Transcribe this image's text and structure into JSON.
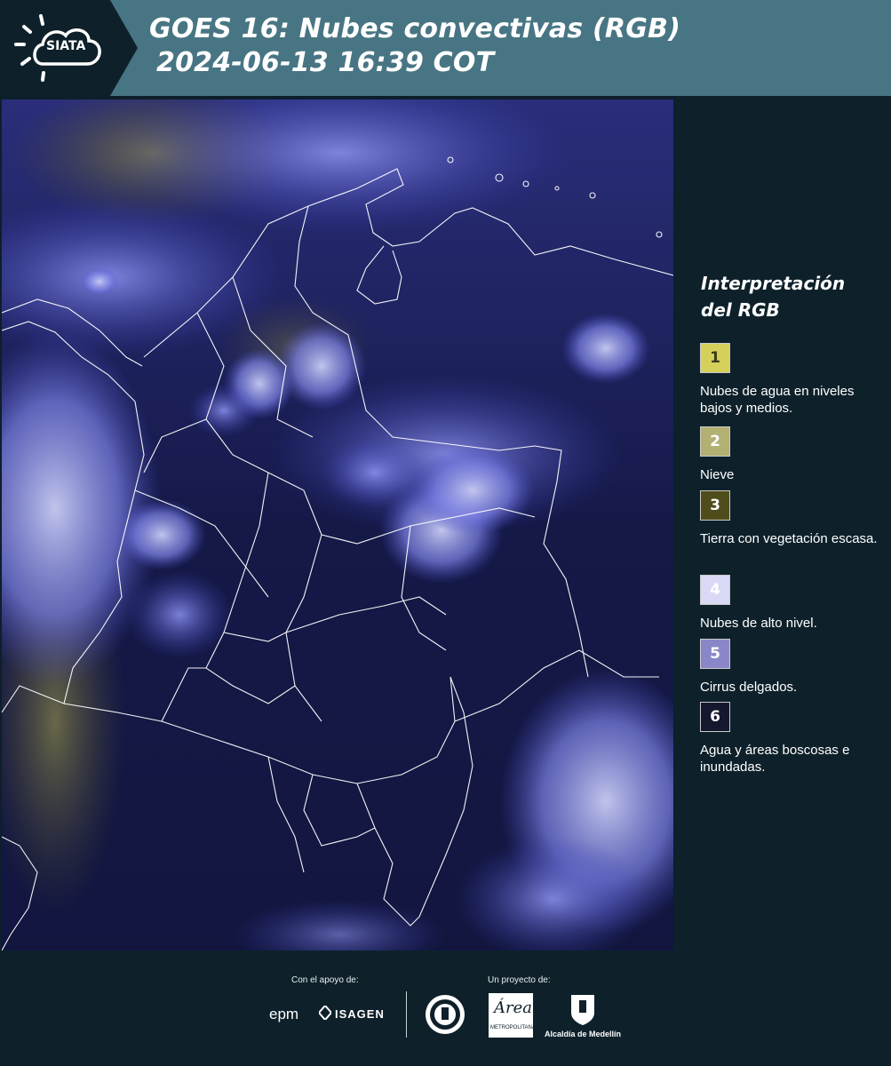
{
  "header": {
    "logo_text": "SIATA",
    "title_line1": "GOES 16: Nubes convectivas (RGB)",
    "title_line2": "2024-06-13 16:39 COT",
    "background_color": "#487583"
  },
  "legend": {
    "title": "Interpretación del RGB",
    "items": [
      {
        "number": "1",
        "label": "Nubes de agua en niveles bajos y medios.",
        "color": "#d4d05a",
        "text_color": "#3a3a1a"
      },
      {
        "number": "2",
        "label": "Nieve",
        "color": "#b3b073",
        "text_color": "#ffffff"
      },
      {
        "number": "3",
        "label": "Tierra con vegetación escasa.",
        "color": "#4f4d1c",
        "text_color": "#ffffff"
      },
      {
        "number": "4",
        "label": "Nubes de alto nivel.",
        "color": "#d9d9f5",
        "text_color": "#ffffff"
      },
      {
        "number": "5",
        "label": "Cirrus delgados.",
        "color": "#8a87c9",
        "text_color": "#ffffff"
      },
      {
        "number": "6",
        "label": "Agua y áreas boscosas e inundadas.",
        "color": "#14172e",
        "text_color": "#ffffff"
      }
    ]
  },
  "footer": {
    "support_caption": "Con el apoyo de:",
    "project_caption": "Un proyecto de:",
    "sponsors": [
      "epm",
      "ISAGEN"
    ],
    "partners": [
      "Área Metropolitana Valle de Aburrá",
      "Alcaldía de Medellín"
    ],
    "metro_small": "METROPOLITANA",
    "alcaldia_label": "Alcaldía de Medellín"
  }
}
